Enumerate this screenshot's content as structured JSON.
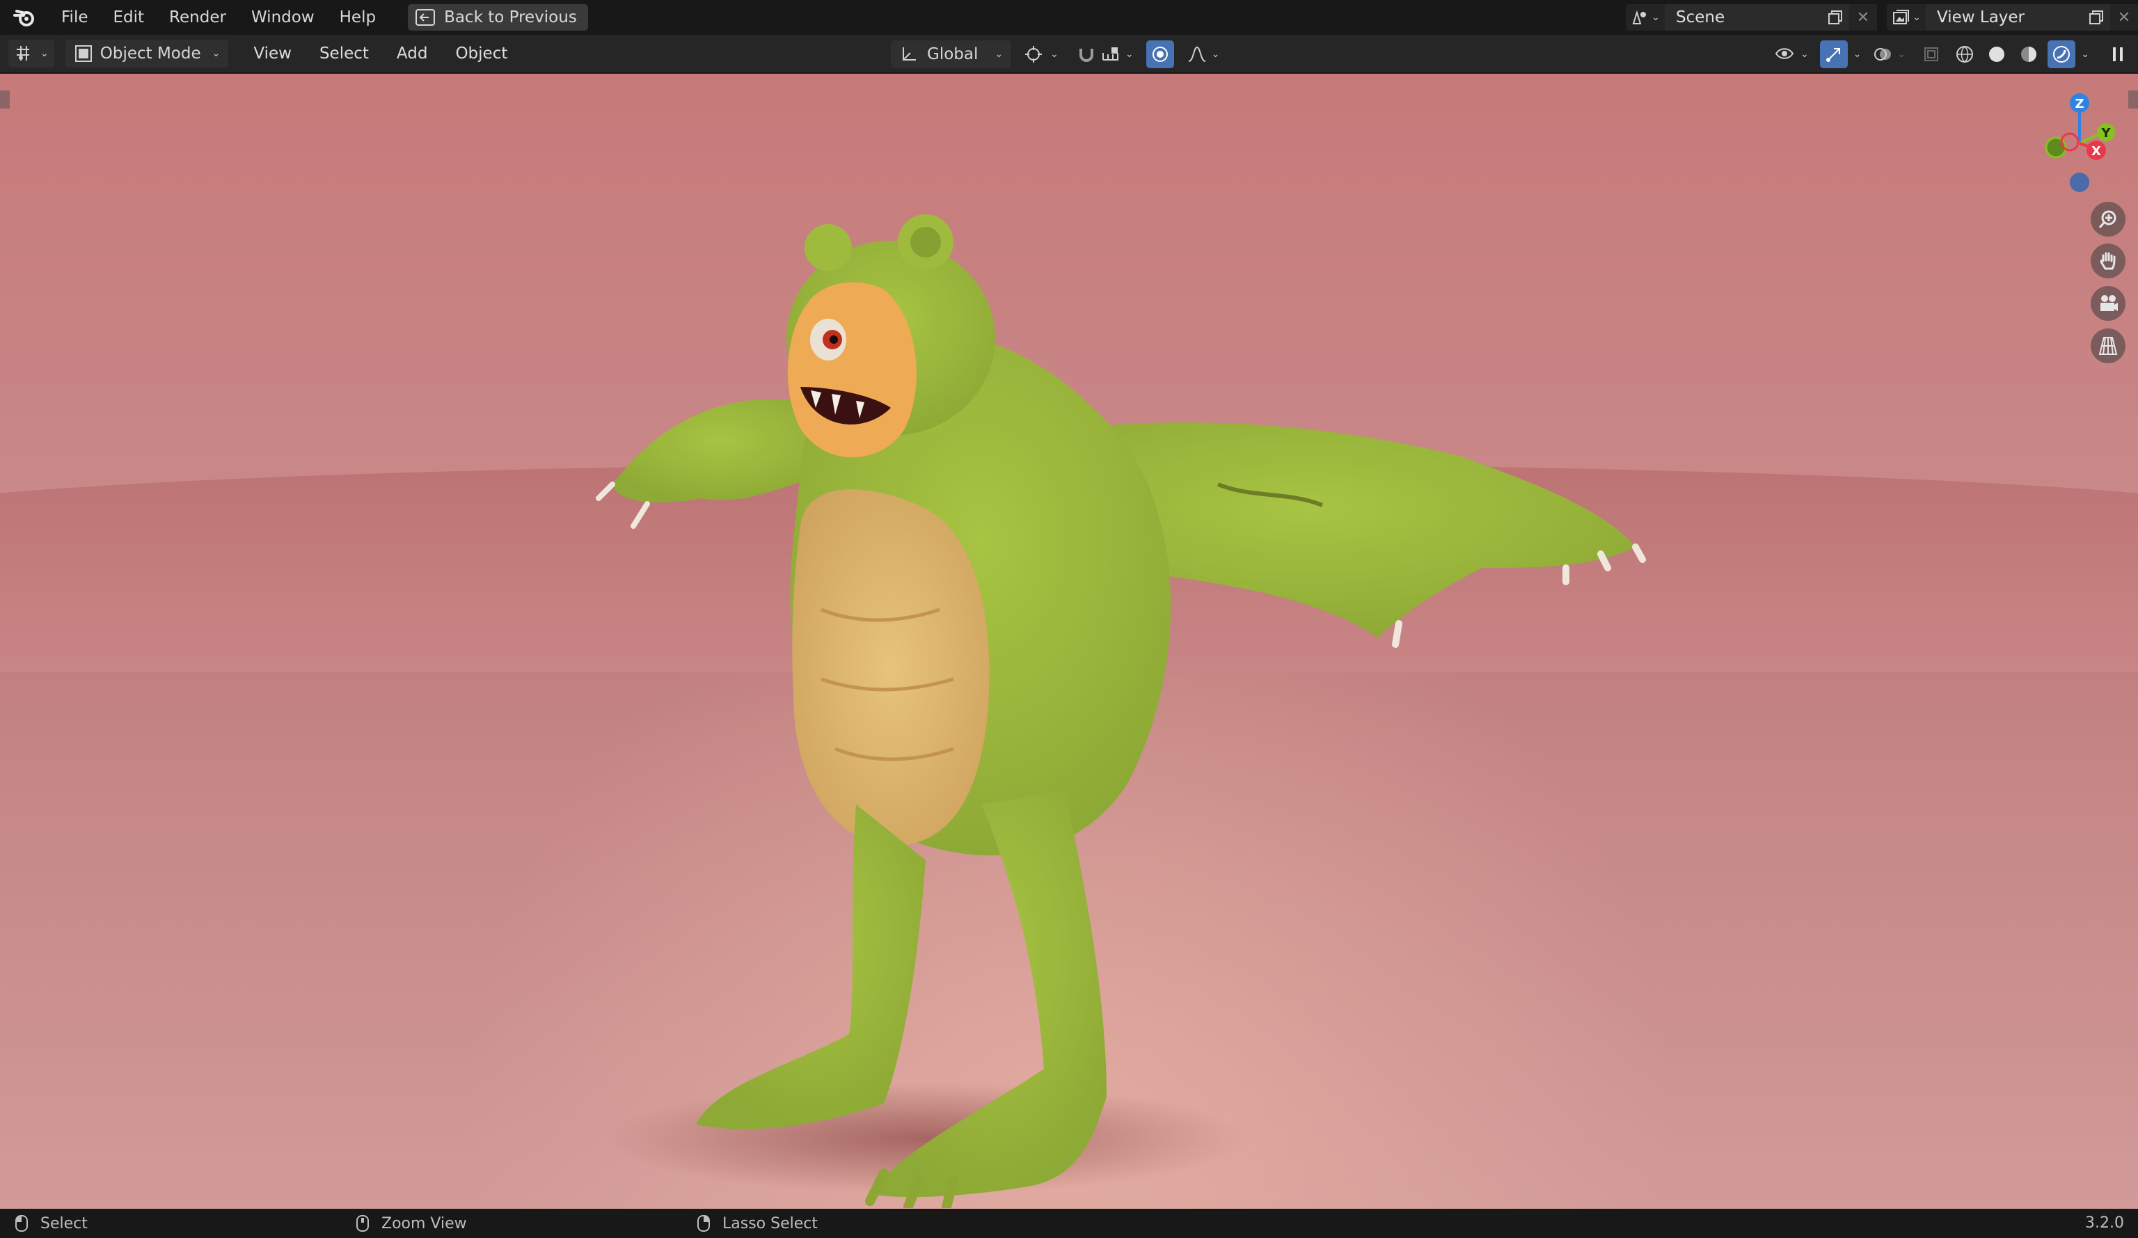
{
  "menubar": {
    "items": [
      "File",
      "Edit",
      "Render",
      "Window",
      "Help"
    ],
    "back_label": "Back to Previous",
    "scene_name": "Scene",
    "view_layer_name": "View Layer"
  },
  "header": {
    "mode_label": "Object Mode",
    "menus": [
      "View",
      "Select",
      "Add",
      "Object"
    ],
    "transform_orientation": "Global"
  },
  "gizmo": {
    "z_label": "Z",
    "y_label": "Y",
    "x_label": "X"
  },
  "statusbar": {
    "items": [
      "Select",
      "Zoom View",
      "Lasso Select"
    ],
    "version": "3.2.0"
  },
  "icons": {
    "logo": "blender-logo-icon",
    "back": "back-to-previous-icon",
    "zoom": "zoom-icon",
    "pan": "pan-hand-icon",
    "camera": "camera-icon",
    "perspective": "perspective-grid-icon"
  },
  "colors": {
    "accent": "#4772b3",
    "axis_x": "#e8394a",
    "axis_y": "#85c21f",
    "axis_z": "#2f84e2",
    "viewport_bg": "#c98889"
  }
}
